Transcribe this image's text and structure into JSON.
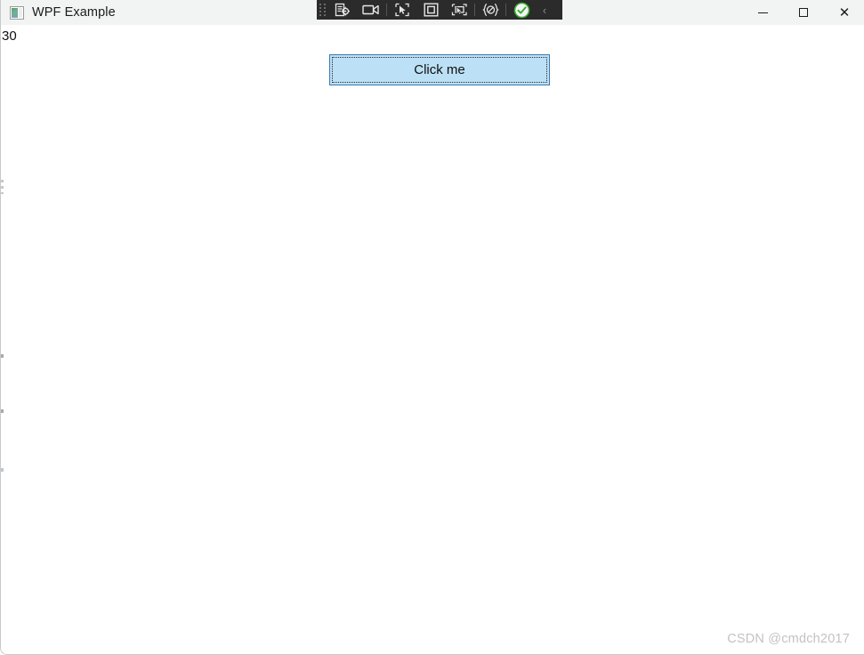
{
  "window": {
    "title": "WPF Example",
    "app_icon": "image-thumbnail-icon",
    "controls": {
      "minimize_label": "Minimize",
      "maximize_label": "Maximize",
      "close_label": "Close",
      "close_glyph": "✕"
    }
  },
  "dev_toolbar": {
    "background": "#2b2b2b",
    "grip_label": "drag-handle",
    "buttons": [
      {
        "name": "live-visual-tree-icon",
        "label": "Go to Live Visual Tree"
      },
      {
        "name": "record-camera-icon",
        "label": "Screenshot / Record"
      },
      {
        "name": "select-element-cursor-icon",
        "label": "Select Element"
      },
      {
        "name": "display-layout-adorner-icon",
        "label": "Display Layout Adorners"
      },
      {
        "name": "track-focused-element-icon",
        "label": "Track Focused Element"
      },
      {
        "name": "xaml-braces-icon",
        "label": "XAML Hot Reload"
      },
      {
        "name": "hot-reload-check-icon",
        "label": "Hot Reload Enabled",
        "color": "#3eaa35"
      }
    ],
    "collapse_glyph": "‹",
    "collapse_label": "Collapse toolbar"
  },
  "content": {
    "counter_value": "30",
    "button": {
      "label": "Click me",
      "fill": "#bce0f5",
      "border": "#3a79b8",
      "focused": true
    }
  },
  "watermark": {
    "text": "CSDN @cmdch2017"
  }
}
